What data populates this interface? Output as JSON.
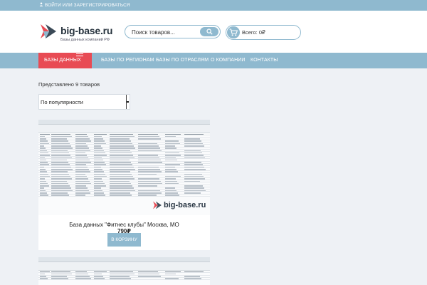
{
  "topbar": {
    "login_text": "ВОЙТИ ИЛИ ЗАРЕГИСТРИРОВАТЬСЯ",
    "icon": "user-icon"
  },
  "header": {
    "logo_title": "big-base.ru",
    "logo_subtitle": "Базы данных компаний РФ",
    "search": {
      "placeholder": "Поиск товаров...",
      "value": ""
    },
    "cart_total": "Всего: 0₽"
  },
  "colors": {
    "accent": "#8fb9cf",
    "active_nav": "#e84b54",
    "page_bg": "#eef1f5"
  },
  "nav": {
    "items": [
      {
        "label": "БАЗЫ ДАННЫХ",
        "active": true
      },
      {
        "label": "БАЗЫ ПО РЕГИОНАМ"
      },
      {
        "label": "БАЗЫ ПО ОТРАСЛЯМ"
      },
      {
        "label": "О КОМПАНИИ"
      },
      {
        "label": "КОНТАКТЫ"
      }
    ]
  },
  "catalog": {
    "result_count": "Представлено 9 товаров",
    "sort_selected": "По популярности",
    "products": [
      {
        "watermark": "big-base.ru",
        "title": "База данных \"Фитнес клубы\" Москва, МО",
        "price": "790₽",
        "button": "В КОРЗИНУ"
      }
    ]
  }
}
